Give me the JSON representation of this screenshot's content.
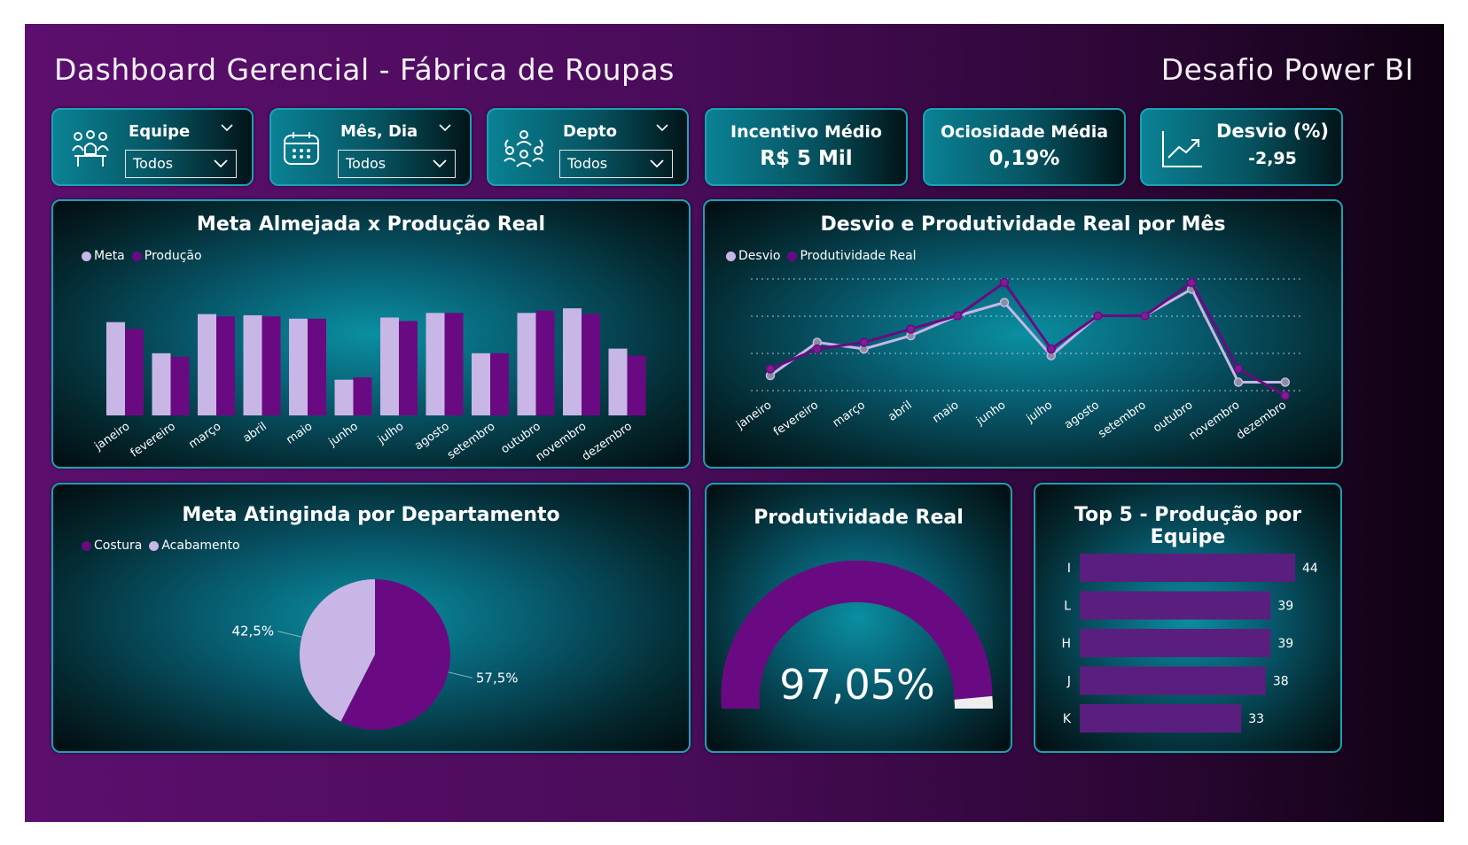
{
  "header": {
    "title": "Dashboard Gerencial - Fábrica de Roupas",
    "subtitle": "Desafio Power BI"
  },
  "slicers": [
    {
      "label": "Equipe",
      "value": "Todos",
      "icon": "team-icon"
    },
    {
      "label": "Mês, Dia",
      "value": "Todos",
      "icon": "calendar-icon"
    },
    {
      "label": "Depto",
      "value": "Todos",
      "icon": "department-icon"
    }
  ],
  "kpis": {
    "incentivo": {
      "title": "Incentivo Médio",
      "value": "R$ 5 Mil"
    },
    "ociosidade": {
      "title": "Ociosidade Média",
      "value": "0,19%"
    },
    "desvio": {
      "title": "Desvio (%)",
      "value": "-2,95",
      "icon": "trend-up-icon"
    }
  },
  "colors": {
    "light_purple": "#c8b6e6",
    "dark_purple": "#6a0a82",
    "accent_teal": "#1aa2b6"
  },
  "chart_data": [
    {
      "type": "bar",
      "title": "Meta Almejada x Produção Real",
      "categories": [
        "janeiro",
        "fevereiro",
        "março",
        "abril",
        "maio",
        "junho",
        "julho",
        "agosto",
        "setembro",
        "outubro",
        "novembro",
        "dezembro"
      ],
      "series": [
        {
          "name": "Meta",
          "values": [
            81,
            54,
            88,
            87,
            84,
            31,
            85,
            89,
            54,
            89,
            93,
            58
          ]
        },
        {
          "name": "Produção",
          "values": [
            75,
            51,
            86,
            86,
            84,
            33,
            82,
            89,
            54,
            91,
            88,
            52
          ]
        }
      ],
      "ylim": [
        0,
        100
      ]
    },
    {
      "type": "line",
      "title": "Desvio e Produtividade Real por Mês",
      "categories": [
        "janeiro",
        "fevereiro",
        "março",
        "abril",
        "maio",
        "junho",
        "julho",
        "agosto",
        "setembro",
        "outubro",
        "novembro",
        "dezembro"
      ],
      "series": [
        {
          "name": "Desvio",
          "values": [
            82,
            87,
            86,
            88,
            91,
            93,
            85,
            91,
            91,
            95,
            81,
            81
          ]
        },
        {
          "name": "Produtividade Real",
          "values": [
            83,
            86,
            87,
            89,
            91,
            96,
            86,
            91,
            91,
            96,
            83,
            79
          ]
        }
      ],
      "ylim": [
        76,
        100
      ]
    },
    {
      "type": "pie",
      "title": "Meta Atinginda por Departamento",
      "labels": [
        "Costura",
        "Acabamento"
      ],
      "values": [
        57.5,
        42.5
      ],
      "value_labels": [
        "57,5%",
        "42,5%"
      ]
    },
    {
      "type": "gauge",
      "title": "Produtividade Real",
      "value": 97.05,
      "max": 100,
      "value_label": "97,05%"
    },
    {
      "type": "bar",
      "orientation": "horizontal",
      "title": "Top 5 - Produção por Equipe",
      "categories": [
        "I",
        "L",
        "H",
        "J",
        "K"
      ],
      "values": [
        44,
        39,
        39,
        38,
        33
      ],
      "xlim": [
        0,
        44
      ]
    }
  ]
}
